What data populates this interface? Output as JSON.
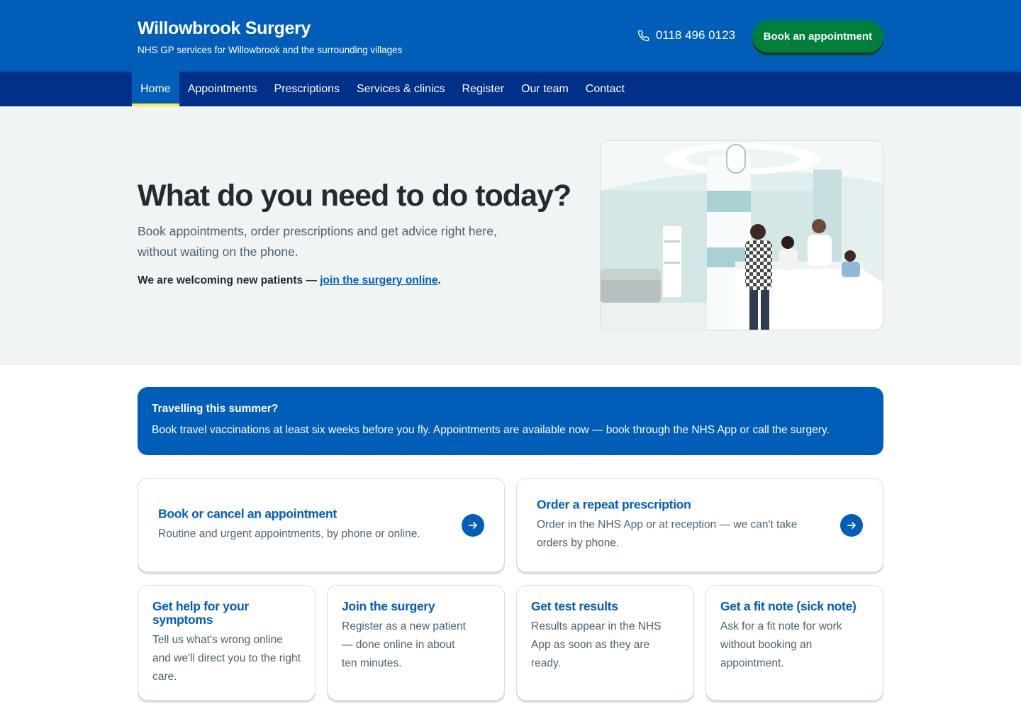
{
  "header": {
    "title": "Willowbrook Surgery",
    "subtitle": "NHS GP services for Willowbrook and the surrounding villages",
    "phone": "0118 496 0123",
    "book_label": "Book an appointment"
  },
  "nav": {
    "items": [
      {
        "label": "Home",
        "active": true
      },
      {
        "label": "Appointments"
      },
      {
        "label": "Prescriptions"
      },
      {
        "label": "Services & clinics"
      },
      {
        "label": "Register"
      },
      {
        "label": "Our team"
      },
      {
        "label": "Contact"
      }
    ]
  },
  "hero": {
    "title": "What do you need to do today?",
    "lead": "Book appointments, order prescriptions and get advice right here, without waiting on the phone.",
    "join_prefix": "We are welcoming new patients — ",
    "join_link": "join the surgery online",
    "join_suffix": "."
  },
  "banner": {
    "title": "Travelling this summer?",
    "text": "Book travel vaccinations at least six weeks before you fly. Appointments are available now — book through the NHS App or call the surgery."
  },
  "cards_primary": [
    {
      "title": "Book or cancel an appointment",
      "desc": "Routine and urgent appointments, by phone or online."
    },
    {
      "title": "Order a repeat prescription",
      "desc": "Order in the NHS App or at reception — we can't take orders by phone."
    }
  ],
  "cards_secondary": [
    {
      "title": "Get help for your symptoms",
      "desc": "Tell us what's wrong online and we'll direct you to the right care."
    },
    {
      "title": "Join the surgery",
      "desc": "Register as a new patient — done online in about ten minutes."
    },
    {
      "title": "Get test results",
      "desc": "Results appear in the NHS App as soon as they are ready."
    },
    {
      "title": "Get a fit note (sick note)",
      "desc": "Ask for a fit note for work without booking an appointment."
    }
  ],
  "colors": {
    "nhs_blue": "#005eb8",
    "nav_dark_blue": "#003087",
    "green_button": "#007f3b",
    "nav_active_underline": "#ffeb3b",
    "hero_background": "#f0f4f5"
  }
}
